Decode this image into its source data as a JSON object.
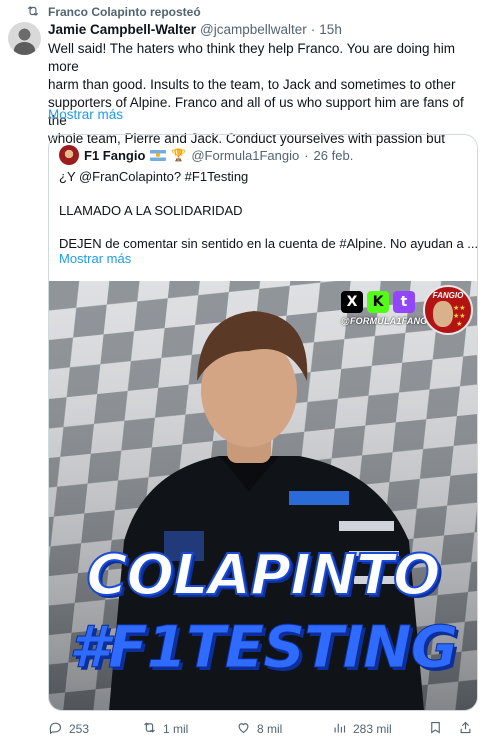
{
  "repost": {
    "icon": "repost-icon",
    "text": "Franco Colapinto reposteó"
  },
  "tweet": {
    "author_name": "Jamie Campbell-Walter",
    "author_handle": "@jcampbellwalter",
    "separator": "·",
    "time": "15h",
    "lines": [
      "Well said! The haters who think they help Franco. You are doing him more",
      "harm than good. Insults to the team, to Jack and sometimes to other",
      "supporters of Alpine. Franco and all of us who support him are fans of the",
      "whole team, Pierre and Jack. Conduct yourselves with passion but"
    ],
    "show_more": "Mostrar más"
  },
  "quote": {
    "author_name": "F1 Fangio",
    "author_handle": "@Formula1Fangio",
    "separator": "·",
    "date": "26 feb.",
    "line1": "¿Y @FranColapinto? #F1Testing",
    "line2": "LLAMADO A LA SOLIDARIDAD",
    "line3": "DEJEN de comentar sin sentido en la cuenta de #Alpine. No ayudan a ...",
    "show_more": "Mostrar más",
    "media": {
      "social_badges": [
        "X",
        "K",
        "t"
      ],
      "handle_tag": "@FORMULA1FANGIO",
      "logo_text": "FANGIO",
      "headline": "COLAPINTO",
      "hashtag": "#F1TESTING",
      "brand_colors": {
        "blue": "#1a4bd6",
        "red": "#b31313",
        "kick": "#53fc18",
        "twitch": "#9146ff"
      }
    }
  },
  "actions": {
    "replies": "253",
    "reposts": "1 mil",
    "likes": "8 mil",
    "views": "283 mil"
  }
}
